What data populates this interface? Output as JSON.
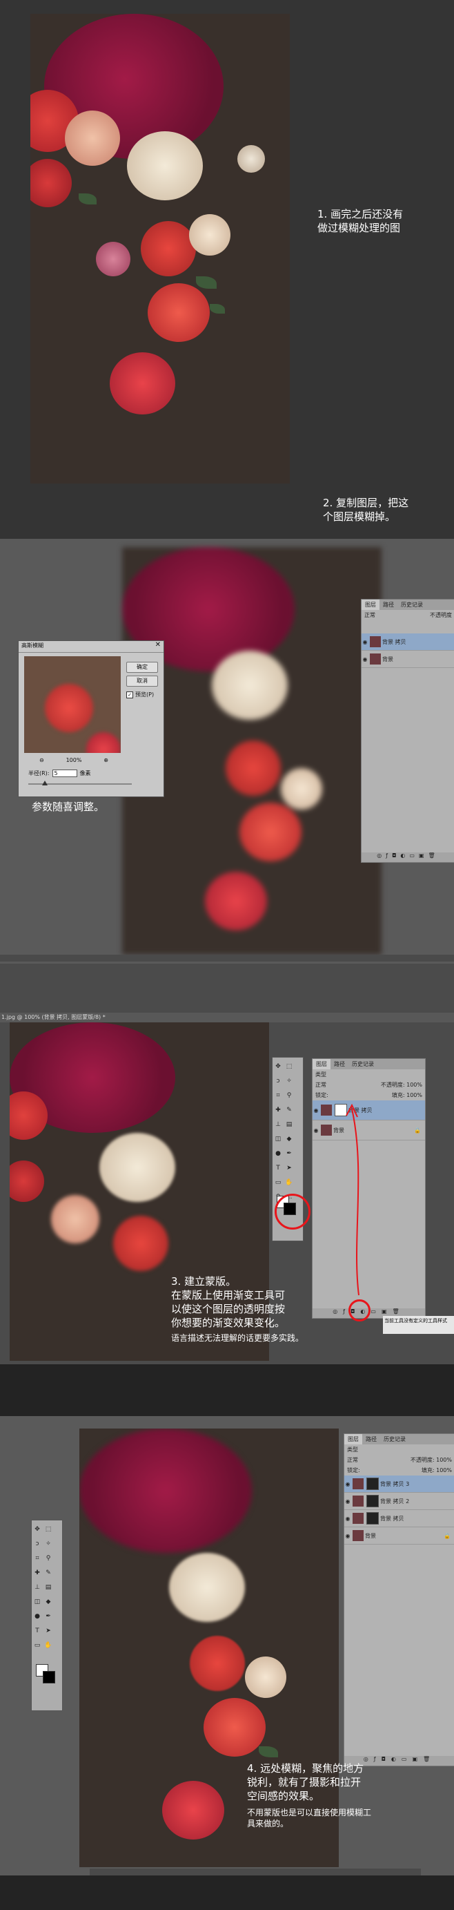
{
  "section1": {
    "note1": "1. 画完之后还没有\n做过模糊处理的图",
    "note2": "2. 复制图层，把这\n个图层模糊掉。"
  },
  "section2": {
    "blur_dialog": {
      "title": "高斯模糊",
      "close_icon": "close-icon",
      "ok_label": "确定",
      "cancel_label": "取消",
      "preview_label": "预览(P)",
      "zoom_value": "100%",
      "radius_label": "半径(R):",
      "radius_value": "5",
      "radius_unit": "像素"
    },
    "note": "参数随喜调整。",
    "layers_panel": {
      "tabs": [
        "图层",
        "路径",
        "历史记录"
      ],
      "mode": "正常",
      "opacity_label": "不透明度",
      "layers": [
        {
          "name": "背景 拷贝",
          "selected": true
        },
        {
          "name": "背景",
          "selected": false
        }
      ]
    }
  },
  "section3": {
    "window_title": "1.jpg @ 100% (背景 拷贝, 图层蒙版/8) *",
    "note_title": "3. 建立蒙版。",
    "note_body": "在蒙版上使用渐变工具可\n以使这个图层的透明度按\n你想要的渐变效果变化。",
    "note_small": "语言描述无法理解的话更要多实践。",
    "layers_panel": {
      "tabs": [
        "图层",
        "路径",
        "历史记录"
      ],
      "kind_label": "类型",
      "mode": "正常",
      "opacity_label": "不透明度:",
      "opacity_value": "100%",
      "lock_label": "锁定:",
      "fill_label": "填充:",
      "fill_value": "100%",
      "layers": [
        {
          "name": "背景 拷贝",
          "has_mask": true,
          "selected": true
        },
        {
          "name": "背景",
          "has_mask": false,
          "selected": false
        }
      ]
    },
    "tooltip": "当前工具没有定义的工具样式"
  },
  "section4": {
    "note_title": "4. 远处模糊，聚焦的地方\n锐利，就有了摄影和拉开\n空间感的效果。",
    "note_small": "不用蒙版也是可以直接使用模糊工\n具来做的。",
    "layers_panel": {
      "tabs": [
        "图层",
        "路径",
        "历史记录"
      ],
      "kind_label": "类型",
      "mode": "正常",
      "opacity_label": "不透明度:",
      "opacity_value": "100%",
      "lock_label": "锁定:",
      "fill_label": "填充:",
      "fill_value": "100%",
      "layers": [
        {
          "name": "背景 拷贝 3",
          "has_mask": true,
          "selected": true
        },
        {
          "name": "背景 拷贝 2",
          "has_mask": true,
          "selected": false
        },
        {
          "name": "背景 拷贝",
          "has_mask": true,
          "selected": false
        },
        {
          "name": "背景",
          "has_mask": false,
          "selected": false
        }
      ]
    }
  },
  "colors": {
    "annotation_red": "#e8151b",
    "canvas_bg": "#39302b",
    "panel_bg": "#b3b3b3"
  }
}
